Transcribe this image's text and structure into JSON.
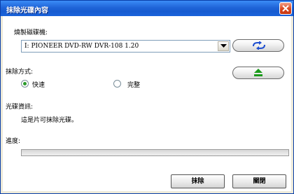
{
  "window": {
    "title": "抹除光碟內容"
  },
  "drive_section": {
    "label": "燒製磁碟機:",
    "selected_drive": "I: PIONEER DVD-RW  DVR-108 1.20"
  },
  "erase_method": {
    "label": "抹除方式:",
    "options": [
      {
        "label": "快速",
        "selected": true
      },
      {
        "label": "完整",
        "selected": false
      }
    ]
  },
  "disc_info": {
    "label": "光碟資訊:",
    "message": "這是片可抹除光碟。"
  },
  "progress": {
    "label": "進度:",
    "value_percent": 0
  },
  "buttons": {
    "erase": "抹除",
    "close": "關閉"
  },
  "icons": {
    "refresh": "refresh-icon",
    "eject": "eject-icon",
    "close": "close-icon",
    "dropdown": "chevron-down-icon"
  },
  "colors": {
    "titlebar": "#1f64d8",
    "eject_arrow": "#1a9a1a",
    "refresh_arrows": "#1f4fd0"
  }
}
